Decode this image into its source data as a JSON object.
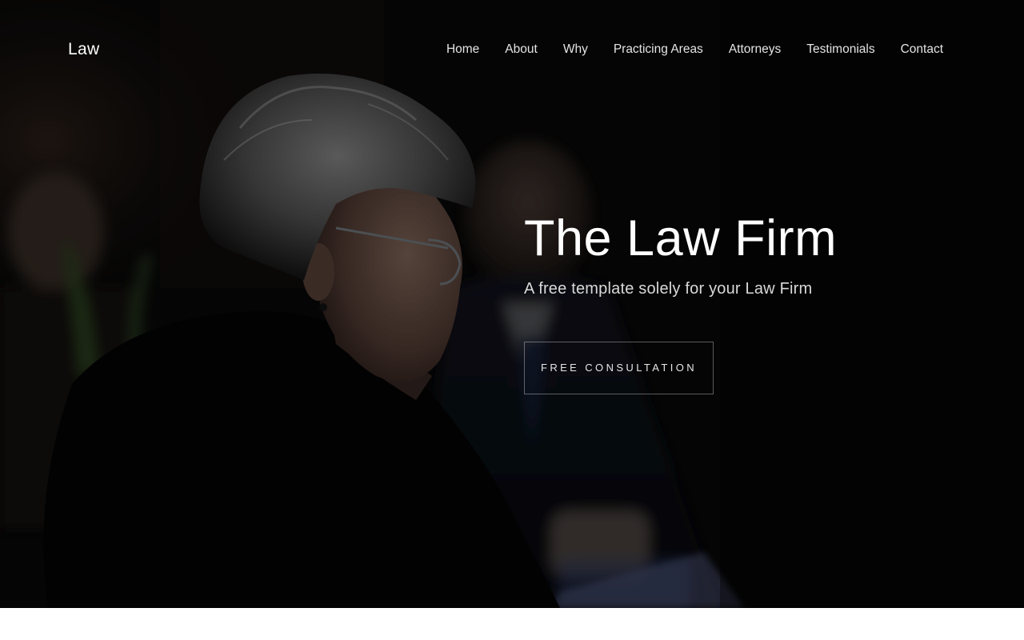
{
  "brand": {
    "name": "Law"
  },
  "nav": {
    "items": [
      {
        "label": "Home"
      },
      {
        "label": "About"
      },
      {
        "label": "Why"
      },
      {
        "label": "Practicing Areas"
      },
      {
        "label": "Attorneys"
      },
      {
        "label": "Testimonials"
      },
      {
        "label": "Contact"
      }
    ]
  },
  "hero": {
    "title": "The Law Firm",
    "subtitle": "A free template solely for your Law Firm",
    "cta_label": "FREE CONSULTATION",
    "image_subject": "elderly woman with glasses in a dim courtroom"
  },
  "colors": {
    "hero_background": "#0b0b0b",
    "text_primary": "#ffffff",
    "text_muted": "#d9d9d9",
    "button_border": "#8a8a8a",
    "page_background": "#ffffff"
  }
}
